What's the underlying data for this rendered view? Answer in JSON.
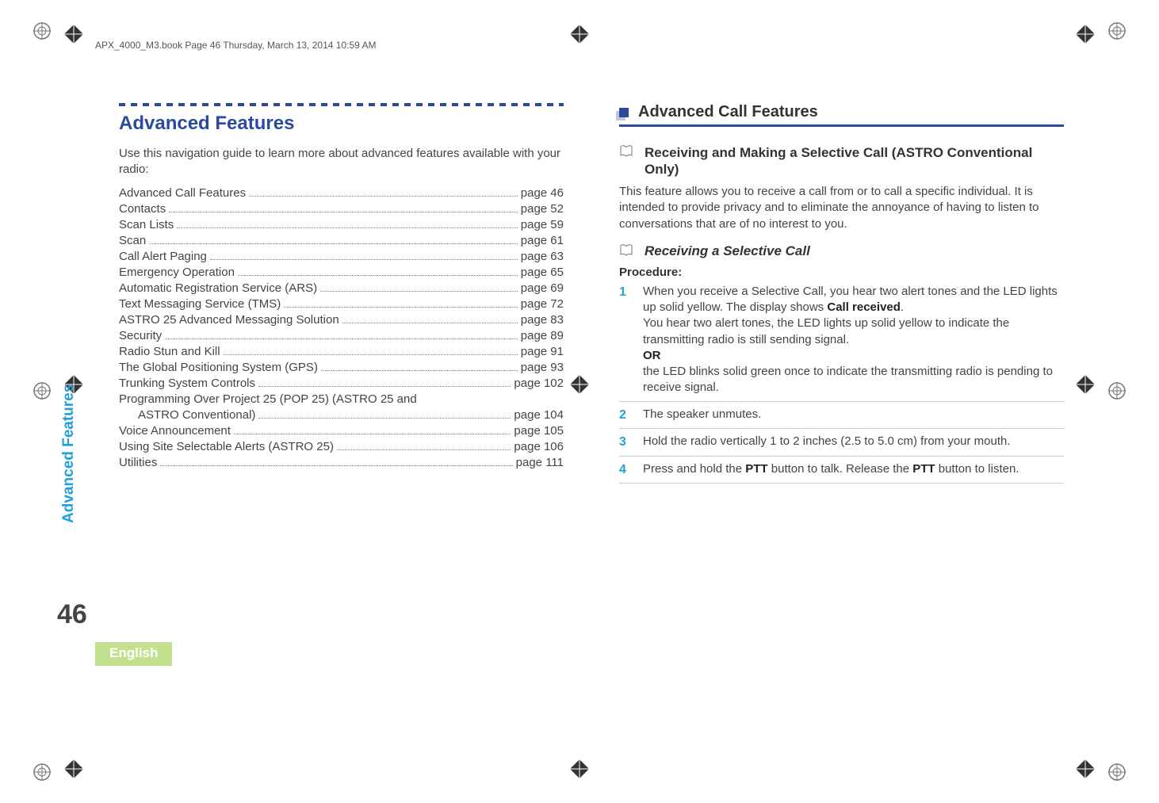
{
  "header_line": "APX_4000_M3.book  Page 46  Thursday, March 13, 2014  10:59 AM",
  "side_tab": "Advanced Features",
  "page_number": "46",
  "language": "English",
  "left": {
    "section_title": "Advanced Features",
    "intro": "Use this navigation guide to learn more about advanced features available with your radio:",
    "toc": [
      {
        "label": "Advanced Call Features",
        "page": "page 46"
      },
      {
        "label": "Contacts",
        "page": "page 52"
      },
      {
        "label": "Scan Lists",
        "page": "page 59"
      },
      {
        "label": "Scan",
        "page": "page 61"
      },
      {
        "label": "Call Alert Paging",
        "page": "page 63"
      },
      {
        "label": "Emergency Operation",
        "page": "page 65"
      },
      {
        "label": "Automatic Registration Service (ARS)",
        "page": "page 69"
      },
      {
        "label": "Text Messaging Service (TMS)",
        "page": "page 72"
      },
      {
        "label": "ASTRO 25 Advanced Messaging Solution",
        "page": "page 83"
      },
      {
        "label": "Security",
        "page": "page 89"
      },
      {
        "label": "Radio Stun and Kill",
        "page": "page 91"
      },
      {
        "label": "The Global Positioning System (GPS)",
        "page": "page 93"
      },
      {
        "label": "Trunking System Controls",
        "page": "page 102"
      },
      {
        "label": "Programming Over Project 25 (POP 25) (ASTRO 25 and",
        "page": ""
      },
      {
        "label_sub": "ASTRO Conventional)",
        "page": "page 104"
      },
      {
        "label": "Voice Announcement",
        "page": "page 105"
      },
      {
        "label": "Using Site Selectable Alerts (ASTRO 25)",
        "page": "page 106"
      },
      {
        "label": "Utilities",
        "page": "page 111"
      }
    ]
  },
  "right": {
    "subsection_title": "Advanced Call Features",
    "topic1_title": "Receiving and Making a Selective Call (ASTRO Conventional Only)",
    "topic1_body": "This feature allows you to receive a call from or to call a specific individual. It is intended to provide privacy and to eliminate the annoyance of having to listen to conversations that are of no interest to you.",
    "topic2_title": "Receiving a Selective Call",
    "procedure_label": "Procedure:",
    "steps": {
      "s1": {
        "num": "1",
        "part1": "When you receive a Selective Call, you hear two alert tones and the LED lights up solid yellow. The display shows ",
        "disp": "Call received",
        "dot": ".",
        "part2": "You hear two alert tones, the LED lights up solid yellow to indicate the transmitting radio is still sending signal.",
        "or": "OR",
        "part3": "the LED blinks solid green once to indicate the transmitting radio is pending to receive signal."
      },
      "s2": {
        "num": "2",
        "text": "The speaker unmutes."
      },
      "s3": {
        "num": "3",
        "text": "Hold the radio vertically 1 to 2 inches (2.5 to 5.0 cm) from your mouth."
      },
      "s4": {
        "num": "4",
        "pre": "Press and hold the ",
        "ptt1": "PTT",
        "mid": " button to talk. Release the ",
        "ptt2": "PTT",
        "post": " button to listen."
      }
    }
  }
}
